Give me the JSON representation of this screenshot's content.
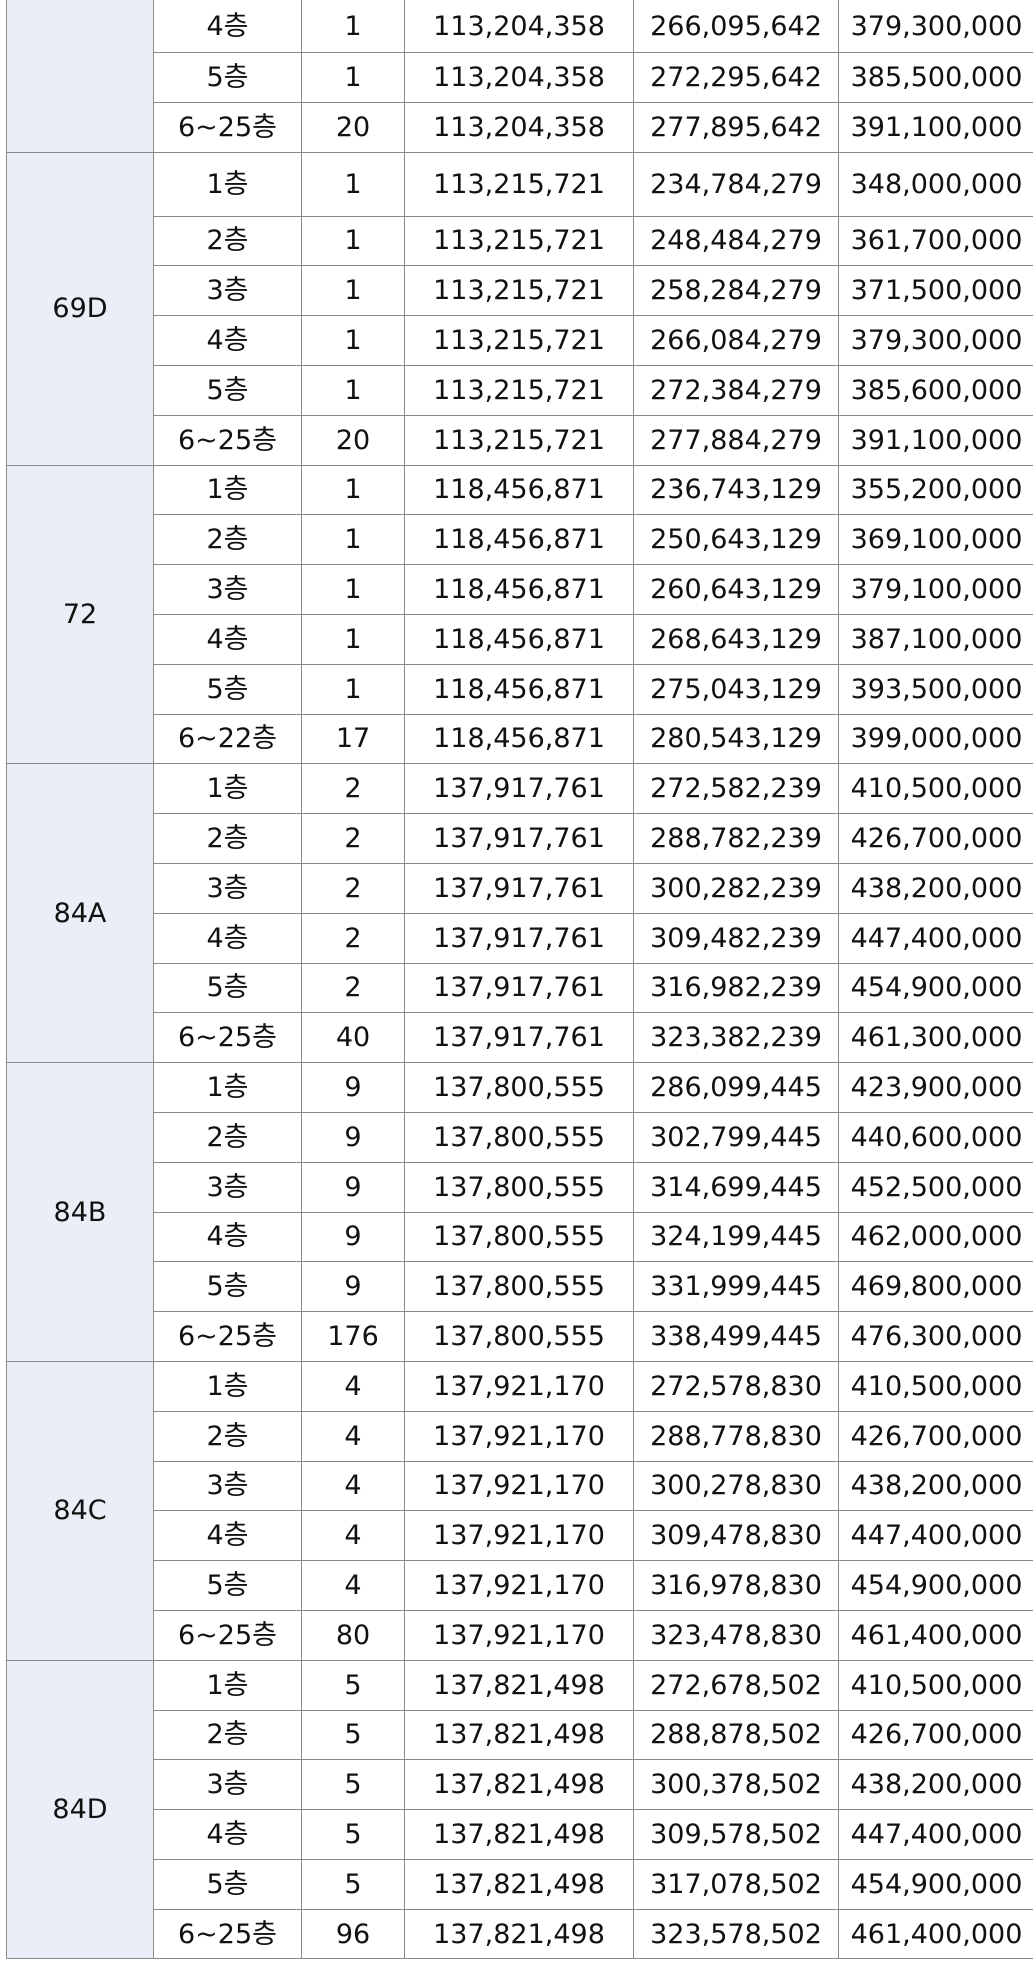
{
  "groups": [
    {
      "type": "",
      "rows": [
        {
          "floor": "4층",
          "units": "1",
          "land": "113,204,358",
          "building": "266,095,642",
          "total": "379,300,000"
        },
        {
          "floor": "5층",
          "units": "1",
          "land": "113,204,358",
          "building": "272,295,642",
          "total": "385,500,000"
        },
        {
          "floor": "6~25층",
          "units": "20",
          "land": "113,204,358",
          "building": "277,895,642",
          "total": "391,100,000"
        }
      ]
    },
    {
      "type": "69D",
      "rows": [
        {
          "floor": "1층",
          "units": "1",
          "land": "113,215,721",
          "building": "234,784,279",
          "total": "348,000,000"
        },
        {
          "floor": "2층",
          "units": "1",
          "land": "113,215,721",
          "building": "248,484,279",
          "total": "361,700,000"
        },
        {
          "floor": "3층",
          "units": "1",
          "land": "113,215,721",
          "building": "258,284,279",
          "total": "371,500,000"
        },
        {
          "floor": "4층",
          "units": "1",
          "land": "113,215,721",
          "building": "266,084,279",
          "total": "379,300,000"
        },
        {
          "floor": "5층",
          "units": "1",
          "land": "113,215,721",
          "building": "272,384,279",
          "total": "385,600,000"
        },
        {
          "floor": "6~25층",
          "units": "20",
          "land": "113,215,721",
          "building": "277,884,279",
          "total": "391,100,000"
        }
      ]
    },
    {
      "type": "72",
      "rows": [
        {
          "floor": "1층",
          "units": "1",
          "land": "118,456,871",
          "building": "236,743,129",
          "total": "355,200,000"
        },
        {
          "floor": "2층",
          "units": "1",
          "land": "118,456,871",
          "building": "250,643,129",
          "total": "369,100,000"
        },
        {
          "floor": "3층",
          "units": "1",
          "land": "118,456,871",
          "building": "260,643,129",
          "total": "379,100,000"
        },
        {
          "floor": "4층",
          "units": "1",
          "land": "118,456,871",
          "building": "268,643,129",
          "total": "387,100,000"
        },
        {
          "floor": "5층",
          "units": "1",
          "land": "118,456,871",
          "building": "275,043,129",
          "total": "393,500,000"
        },
        {
          "floor": "6~22층",
          "units": "17",
          "land": "118,456,871",
          "building": "280,543,129",
          "total": "399,000,000"
        }
      ]
    },
    {
      "type": "84A",
      "rows": [
        {
          "floor": "1층",
          "units": "2",
          "land": "137,917,761",
          "building": "272,582,239",
          "total": "410,500,000"
        },
        {
          "floor": "2층",
          "units": "2",
          "land": "137,917,761",
          "building": "288,782,239",
          "total": "426,700,000"
        },
        {
          "floor": "3층",
          "units": "2",
          "land": "137,917,761",
          "building": "300,282,239",
          "total": "438,200,000"
        },
        {
          "floor": "4층",
          "units": "2",
          "land": "137,917,761",
          "building": "309,482,239",
          "total": "447,400,000"
        },
        {
          "floor": "5층",
          "units": "2",
          "land": "137,917,761",
          "building": "316,982,239",
          "total": "454,900,000"
        },
        {
          "floor": "6~25층",
          "units": "40",
          "land": "137,917,761",
          "building": "323,382,239",
          "total": "461,300,000"
        }
      ]
    },
    {
      "type": "84B",
      "rows": [
        {
          "floor": "1층",
          "units": "9",
          "land": "137,800,555",
          "building": "286,099,445",
          "total": "423,900,000"
        },
        {
          "floor": "2층",
          "units": "9",
          "land": "137,800,555",
          "building": "302,799,445",
          "total": "440,600,000"
        },
        {
          "floor": "3층",
          "units": "9",
          "land": "137,800,555",
          "building": "314,699,445",
          "total": "452,500,000"
        },
        {
          "floor": "4층",
          "units": "9",
          "land": "137,800,555",
          "building": "324,199,445",
          "total": "462,000,000"
        },
        {
          "floor": "5층",
          "units": "9",
          "land": "137,800,555",
          "building": "331,999,445",
          "total": "469,800,000"
        },
        {
          "floor": "6~25층",
          "units": "176",
          "land": "137,800,555",
          "building": "338,499,445",
          "total": "476,300,000"
        }
      ]
    },
    {
      "type": "84C",
      "rows": [
        {
          "floor": "1층",
          "units": "4",
          "land": "137,921,170",
          "building": "272,578,830",
          "total": "410,500,000"
        },
        {
          "floor": "2층",
          "units": "4",
          "land": "137,921,170",
          "building": "288,778,830",
          "total": "426,700,000"
        },
        {
          "floor": "3층",
          "units": "4",
          "land": "137,921,170",
          "building": "300,278,830",
          "total": "438,200,000"
        },
        {
          "floor": "4층",
          "units": "4",
          "land": "137,921,170",
          "building": "309,478,830",
          "total": "447,400,000"
        },
        {
          "floor": "5층",
          "units": "4",
          "land": "137,921,170",
          "building": "316,978,830",
          "total": "454,900,000"
        },
        {
          "floor": "6~25층",
          "units": "80",
          "land": "137,921,170",
          "building": "323,478,830",
          "total": "461,400,000"
        }
      ]
    },
    {
      "type": "84D",
      "rows": [
        {
          "floor": "1층",
          "units": "5",
          "land": "137,821,498",
          "building": "272,678,502",
          "total": "410,500,000"
        },
        {
          "floor": "2층",
          "units": "5",
          "land": "137,821,498",
          "building": "288,878,502",
          "total": "426,700,000"
        },
        {
          "floor": "3층",
          "units": "5",
          "land": "137,821,498",
          "building": "300,378,502",
          "total": "438,200,000"
        },
        {
          "floor": "4층",
          "units": "5",
          "land": "137,821,498",
          "building": "309,578,502",
          "total": "447,400,000"
        },
        {
          "floor": "5층",
          "units": "5",
          "land": "137,821,498",
          "building": "317,078,502",
          "total": "454,900,000"
        },
        {
          "floor": "6~25층",
          "units": "96",
          "land": "137,821,498",
          "building": "323,578,502",
          "total": "461,400,000"
        }
      ]
    }
  ]
}
